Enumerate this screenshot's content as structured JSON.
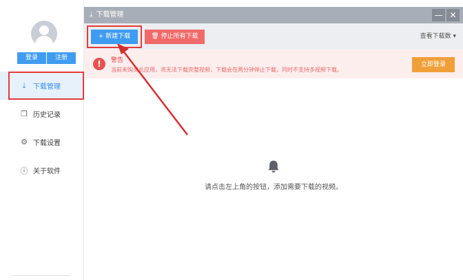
{
  "sidebar": {
    "auth": {
      "login_label": "登录",
      "register_label": "注册"
    },
    "items": [
      {
        "label": "下载管理",
        "icon": "download-icon",
        "glyph": "⤓",
        "active": true
      },
      {
        "label": "历史记录",
        "icon": "history-icon",
        "glyph": "❐",
        "active": false
      },
      {
        "label": "下载设置",
        "icon": "settings-icon",
        "glyph": "⚙",
        "active": false
      },
      {
        "label": "关于软件",
        "icon": "info-icon",
        "glyph": "ⓘ",
        "active": false
      }
    ]
  },
  "titlebar": {
    "title": "下载管理",
    "minimize_glyph": "—",
    "close_glyph": "✕"
  },
  "toolbar": {
    "new_download_label": "+ 新建下载",
    "stop_all_label": "停止所有下载",
    "view_count_label": "查看下载数 ▾"
  },
  "warning": {
    "title": "警告",
    "message": "当前未购买此应用，将无法下载完整视频，下载会在两分钟停止下载，同时不支持多视频下载。",
    "login_now_label": "立即登录"
  },
  "empty_state": {
    "message": "请点击左上角的按钮，添加需要下载的视频。"
  },
  "colors": {
    "accent": "#3f9cf0",
    "danger": "#f06a6a",
    "warning_orange": "#f0a038",
    "highlight_red": "#e53a3a"
  }
}
